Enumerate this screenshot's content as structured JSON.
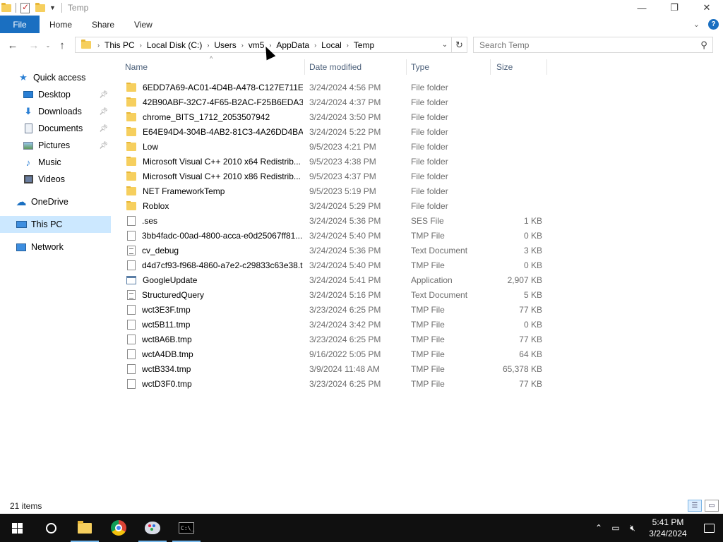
{
  "window": {
    "title": "Temp",
    "controls": {
      "minimize": "—",
      "maximize": "❐",
      "close": "✕"
    }
  },
  "ribbon": {
    "tabs": [
      "File",
      "Home",
      "Share",
      "View"
    ]
  },
  "nav": {
    "back": "←",
    "forward": "→",
    "recent": "⌄",
    "up": "↑",
    "breadcrumbs": [
      "This PC",
      "Local Disk (C:)",
      "Users",
      "vm5",
      "AppData",
      "Local",
      "Temp"
    ],
    "search_placeholder": "Search Temp"
  },
  "sidebar": {
    "items": [
      {
        "label": "Quick access",
        "icon": "star-icon"
      },
      {
        "label": "Desktop",
        "icon": "desktop-icon",
        "pinned": true
      },
      {
        "label": "Downloads",
        "icon": "download-icon",
        "pinned": true
      },
      {
        "label": "Documents",
        "icon": "documents-icon",
        "pinned": true
      },
      {
        "label": "Pictures",
        "icon": "pictures-icon",
        "pinned": true
      },
      {
        "label": "Music",
        "icon": "music-icon"
      },
      {
        "label": "Videos",
        "icon": "videos-icon"
      },
      {
        "label": "OneDrive",
        "icon": "cloud-icon"
      },
      {
        "label": "This PC",
        "icon": "computer-icon",
        "selected": true
      },
      {
        "label": "Network",
        "icon": "network-icon"
      }
    ]
  },
  "columns": {
    "name": "Name",
    "date": "Date modified",
    "type": "Type",
    "size": "Size"
  },
  "files": [
    {
      "name": "6EDD7A69-AC01-4D4B-A478-C127E711E...",
      "date": "3/24/2024 4:56 PM",
      "type": "File folder",
      "size": "",
      "kind": "folder"
    },
    {
      "name": "42B90ABF-32C7-4F65-B2AC-F25B6EDA3...",
      "date": "3/24/2024 4:37 PM",
      "type": "File folder",
      "size": "",
      "kind": "folder"
    },
    {
      "name": "chrome_BITS_1712_2053507942",
      "date": "3/24/2024 3:50 PM",
      "type": "File folder",
      "size": "",
      "kind": "folder"
    },
    {
      "name": "E64E94D4-304B-4AB2-81C3-4A26DD4BA4...",
      "date": "3/24/2024 5:22 PM",
      "type": "File folder",
      "size": "",
      "kind": "folder"
    },
    {
      "name": "Low",
      "date": "9/5/2023 4:21 PM",
      "type": "File folder",
      "size": "",
      "kind": "folder"
    },
    {
      "name": "Microsoft Visual C++ 2010  x64 Redistrib...",
      "date": "9/5/2023 4:38 PM",
      "type": "File folder",
      "size": "",
      "kind": "folder"
    },
    {
      "name": "Microsoft Visual C++ 2010  x86 Redistrib...",
      "date": "9/5/2023 4:37 PM",
      "type": "File folder",
      "size": "",
      "kind": "folder"
    },
    {
      "name": "NET FrameworkTemp",
      "date": "9/5/2023 5:19 PM",
      "type": "File folder",
      "size": "",
      "kind": "folder"
    },
    {
      "name": "Roblox",
      "date": "3/24/2024 5:29 PM",
      "type": "File folder",
      "size": "",
      "kind": "folder"
    },
    {
      "name": ".ses",
      "date": "3/24/2024 5:36 PM",
      "type": "SES File",
      "size": "1 KB",
      "kind": "doc"
    },
    {
      "name": "3bb4fadc-00ad-4800-acca-e0d25067ff81....",
      "date": "3/24/2024 5:40 PM",
      "type": "TMP File",
      "size": "0 KB",
      "kind": "doc"
    },
    {
      "name": "cv_debug",
      "date": "3/24/2024 5:36 PM",
      "type": "Text Document",
      "size": "3 KB",
      "kind": "txt"
    },
    {
      "name": "d4d7cf93-f968-4860-a7e2-c29833c63e38.t...",
      "date": "3/24/2024 5:40 PM",
      "type": "TMP File",
      "size": "0 KB",
      "kind": "doc"
    },
    {
      "name": "GoogleUpdate",
      "date": "3/24/2024 5:41 PM",
      "type": "Application",
      "size": "2,907 KB",
      "kind": "app"
    },
    {
      "name": "StructuredQuery",
      "date": "3/24/2024 5:16 PM",
      "type": "Text Document",
      "size": "5 KB",
      "kind": "txt"
    },
    {
      "name": "wct3E3F.tmp",
      "date": "3/23/2024 6:25 PM",
      "type": "TMP File",
      "size": "77 KB",
      "kind": "doc"
    },
    {
      "name": "wct5B11.tmp",
      "date": "3/24/2024 3:42 PM",
      "type": "TMP File",
      "size": "0 KB",
      "kind": "doc"
    },
    {
      "name": "wct8A6B.tmp",
      "date": "3/23/2024 6:25 PM",
      "type": "TMP File",
      "size": "77 KB",
      "kind": "doc"
    },
    {
      "name": "wctA4DB.tmp",
      "date": "9/16/2022 5:05 PM",
      "type": "TMP File",
      "size": "64 KB",
      "kind": "doc"
    },
    {
      "name": "wctB334.tmp",
      "date": "3/9/2024 11:48 AM",
      "type": "TMP File",
      "size": "65,378 KB",
      "kind": "doc"
    },
    {
      "name": "wctD3F0.tmp",
      "date": "3/23/2024 6:25 PM",
      "type": "TMP File",
      "size": "77 KB",
      "kind": "doc"
    }
  ],
  "status": {
    "item_count": "21 items"
  },
  "taskbar": {
    "apps": [
      "start",
      "cortana",
      "file-explorer",
      "chrome",
      "paint",
      "command-prompt"
    ],
    "clock_time": "5:41 PM",
    "clock_date": "3/24/2024"
  },
  "colors": {
    "accent": "#1a6fc1",
    "selected_bg": "#cce8ff",
    "taskbar": "#101010",
    "folder": "#f6cf5e"
  }
}
